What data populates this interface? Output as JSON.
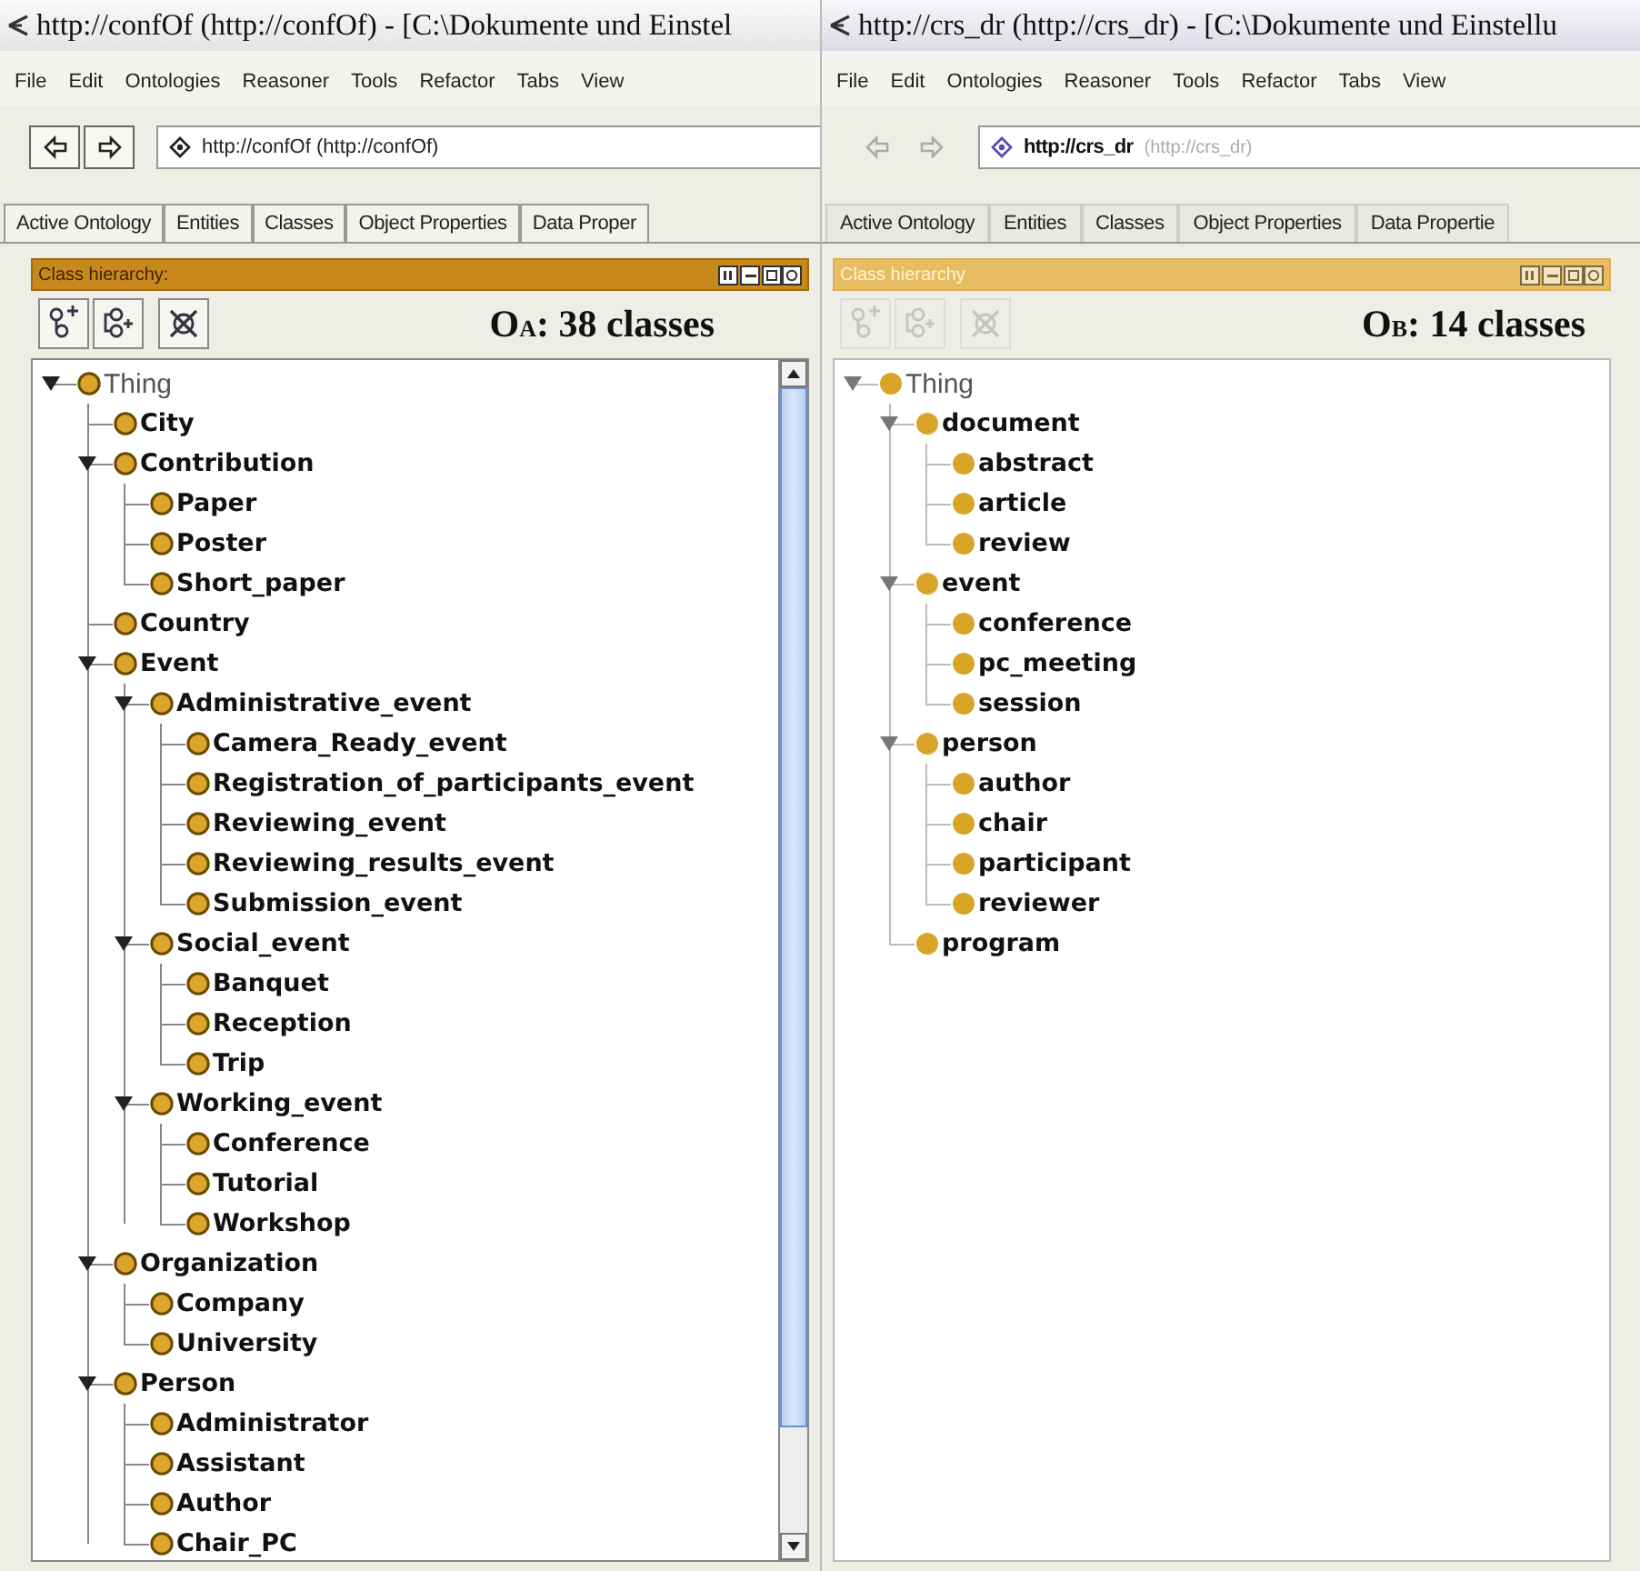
{
  "windows": [
    {
      "title": "http://confOf (http://confOf) - [C:\\Dokumente und Einstel",
      "focused": true,
      "menu": [
        "File",
        "Edit",
        "Ontologies",
        "Reasoner",
        "Tools",
        "Refactor",
        "Tabs",
        "View"
      ],
      "address": {
        "name": "http://confOf (http://confOf)"
      },
      "tabs": [
        "Active Ontology",
        "Entities",
        "Classes",
        "Object Properties",
        "Data Proper"
      ],
      "panel": {
        "title": "Class hierarchy:",
        "summary": "O$_{A}$: 38 classes",
        "scrollbar": true
      },
      "tree": [
        {
          "label": "Thing",
          "expanded": true,
          "children": [
            {
              "label": "City"
            },
            {
              "label": "Contribution",
              "expanded": true,
              "children": [
                {
                  "label": "Paper"
                },
                {
                  "label": "Poster"
                },
                {
                  "label": "Short_paper"
                }
              ]
            },
            {
              "label": "Country"
            },
            {
              "label": "Event",
              "expanded": true,
              "children": [
                {
                  "label": "Administrative_event",
                  "expanded": true,
                  "children": [
                    {
                      "label": "Camera_Ready_event"
                    },
                    {
                      "label": "Registration_of_participants_event"
                    },
                    {
                      "label": "Reviewing_event"
                    },
                    {
                      "label": "Reviewing_results_event"
                    },
                    {
                      "label": "Submission_event"
                    }
                  ]
                },
                {
                  "label": "Social_event",
                  "expanded": true,
                  "children": [
                    {
                      "label": "Banquet"
                    },
                    {
                      "label": "Reception"
                    },
                    {
                      "label": "Trip"
                    }
                  ]
                },
                {
                  "label": "Working_event",
                  "expanded": true,
                  "children": [
                    {
                      "label": "Conference"
                    },
                    {
                      "label": "Tutorial"
                    },
                    {
                      "label": "Workshop"
                    }
                  ]
                }
              ]
            },
            {
              "label": "Organization",
              "expanded": true,
              "children": [
                {
                  "label": "Company"
                },
                {
                  "label": "University"
                }
              ]
            },
            {
              "label": "Person",
              "expanded": true,
              "children": [
                {
                  "label": "Administrator"
                },
                {
                  "label": "Assistant"
                },
                {
                  "label": "Author"
                },
                {
                  "label": "Chair_PC"
                }
              ]
            }
          ]
        }
      ]
    },
    {
      "title": "http://crs_dr (http://crs_dr) - [C:\\Dokumente und Einstellu",
      "focused": false,
      "menu": [
        "File",
        "Edit",
        "Ontologies",
        "Reasoner",
        "Tools",
        "Refactor",
        "Tabs",
        "View"
      ],
      "address": {
        "name": "http://crs_dr",
        "detail": "(http://crs_dr)"
      },
      "tabs": [
        "Active Ontology",
        "Entities",
        "Classes",
        "Object Properties",
        "Data Propertie"
      ],
      "panel": {
        "title": "Class hierarchy",
        "summary": "O$_{B}$: 14 classes",
        "scrollbar": false
      },
      "tree": [
        {
          "label": "Thing",
          "expanded": true,
          "children": [
            {
              "label": "document",
              "expanded": true,
              "children": [
                {
                  "label": "abstract"
                },
                {
                  "label": "article"
                },
                {
                  "label": "review"
                }
              ]
            },
            {
              "label": "event",
              "expanded": true,
              "children": [
                {
                  "label": "conference"
                },
                {
                  "label": "pc_meeting"
                },
                {
                  "label": "session"
                }
              ]
            },
            {
              "label": "person",
              "expanded": true,
              "children": [
                {
                  "label": "author"
                },
                {
                  "label": "chair"
                },
                {
                  "label": "participant"
                },
                {
                  "label": "reviewer"
                }
              ]
            },
            {
              "label": "program"
            }
          ]
        }
      ]
    }
  ]
}
